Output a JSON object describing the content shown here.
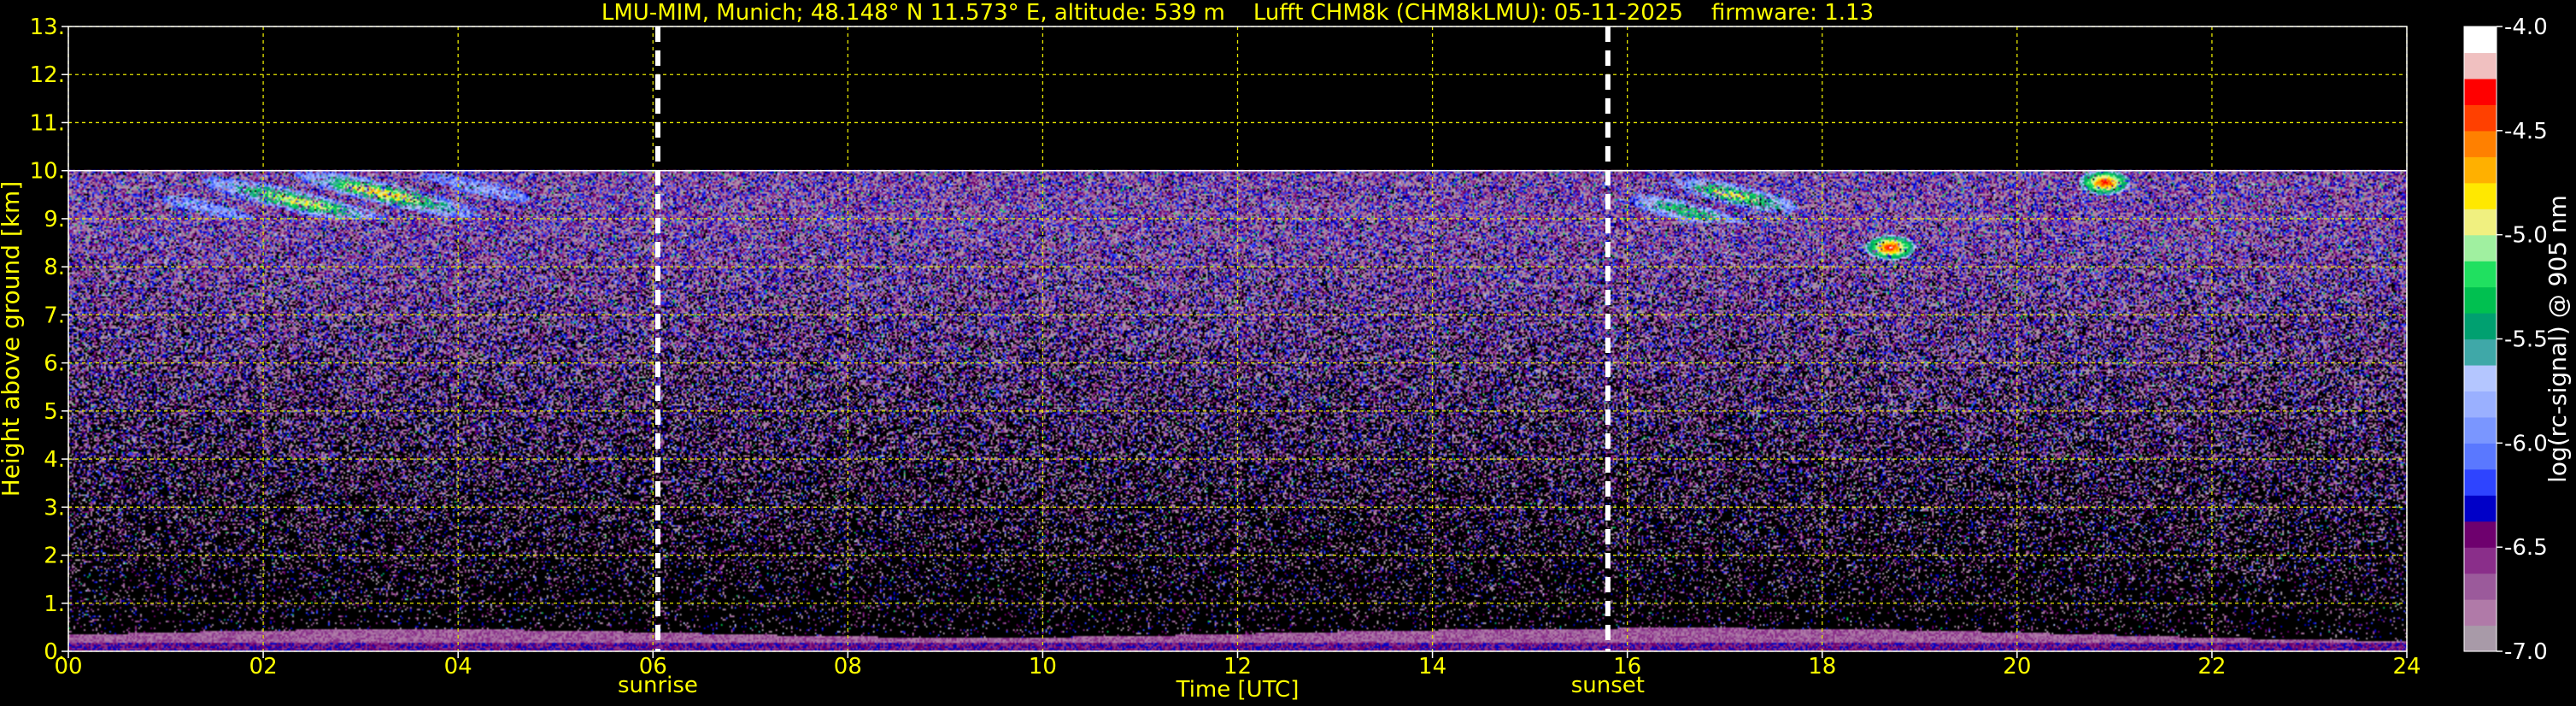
{
  "chart_data": {
    "type": "heatmap",
    "title": "LMU-MIM, Munich; 48.148° N 11.573° E, altitude: 539 m    Lufft CHM8k (CHM8kLMU): 05-11-2025    firmware: 1.13",
    "xlabel": "Time [UTC]",
    "ylabel": "Height above ground [km]",
    "xlim": [
      0,
      24
    ],
    "ylim": [
      0,
      13
    ],
    "x_ticks": [
      0,
      2,
      4,
      6,
      8,
      10,
      12,
      14,
      16,
      18,
      20,
      22,
      24
    ],
    "x_tick_labels": [
      "00",
      "02",
      "04",
      "06",
      "08",
      "10",
      "12",
      "14",
      "16",
      "18",
      "20",
      "22",
      "24"
    ],
    "y_ticks": [
      0,
      1,
      2,
      3,
      4,
      5,
      6,
      7,
      8,
      9,
      10,
      11,
      12,
      13
    ],
    "y_tick_labels": [
      "0.",
      "1.",
      "2.",
      "3.",
      "4.",
      "5.",
      "6.",
      "7.",
      "8.",
      "9.",
      "10.",
      "11.",
      "12.",
      "13."
    ],
    "grid": true,
    "data_top_km": 10,
    "colorbar": {
      "label": "log(rc-signal) @ 905 nm",
      "range": [
        -7.0,
        -4.0
      ],
      "ticks": [
        -4.0,
        -4.5,
        -5.0,
        -5.5,
        -6.0,
        -6.5,
        -7.0
      ],
      "tick_labels": [
        "-4.0",
        "-4.5",
        "-5.0",
        "-5.5",
        "-6.0",
        "-6.5",
        "-7.0"
      ],
      "colors": [
        "#a89aa8",
        "#b07aa8",
        "#9b5a9b",
        "#8a2e8a",
        "#6e006e",
        "#0000c8",
        "#2e44ff",
        "#5a78ff",
        "#7a96ff",
        "#9ab0ff",
        "#b4c6ff",
        "#3fa8a8",
        "#00a070",
        "#00c050",
        "#20e060",
        "#a0f0a0",
        "#f0f080",
        "#ffe800",
        "#ffb000",
        "#ff8000",
        "#ff4000",
        "#ff0000",
        "#f0c0c0",
        "#ffffff"
      ]
    },
    "annotations": [
      {
        "label": "sunrise",
        "x": 6.05
      },
      {
        "label": "sunset",
        "x": 15.8
      }
    ],
    "features": [
      {
        "kind": "cirrus",
        "x_range": [
          0.7,
          5.0
        ],
        "y_range": [
          9.0,
          10.0
        ]
      },
      {
        "kind": "cirrus",
        "x_range": [
          15.9,
          17.9
        ],
        "y_range": [
          8.9,
          10.0
        ]
      },
      {
        "kind": "cloud",
        "x": 18.7,
        "y": 8.4
      },
      {
        "kind": "cloud",
        "x": 20.9,
        "y": 9.75
      },
      {
        "kind": "boundary-layer",
        "x_range": [
          0,
          24
        ],
        "y_range": [
          0,
          0.55
        ]
      }
    ]
  }
}
